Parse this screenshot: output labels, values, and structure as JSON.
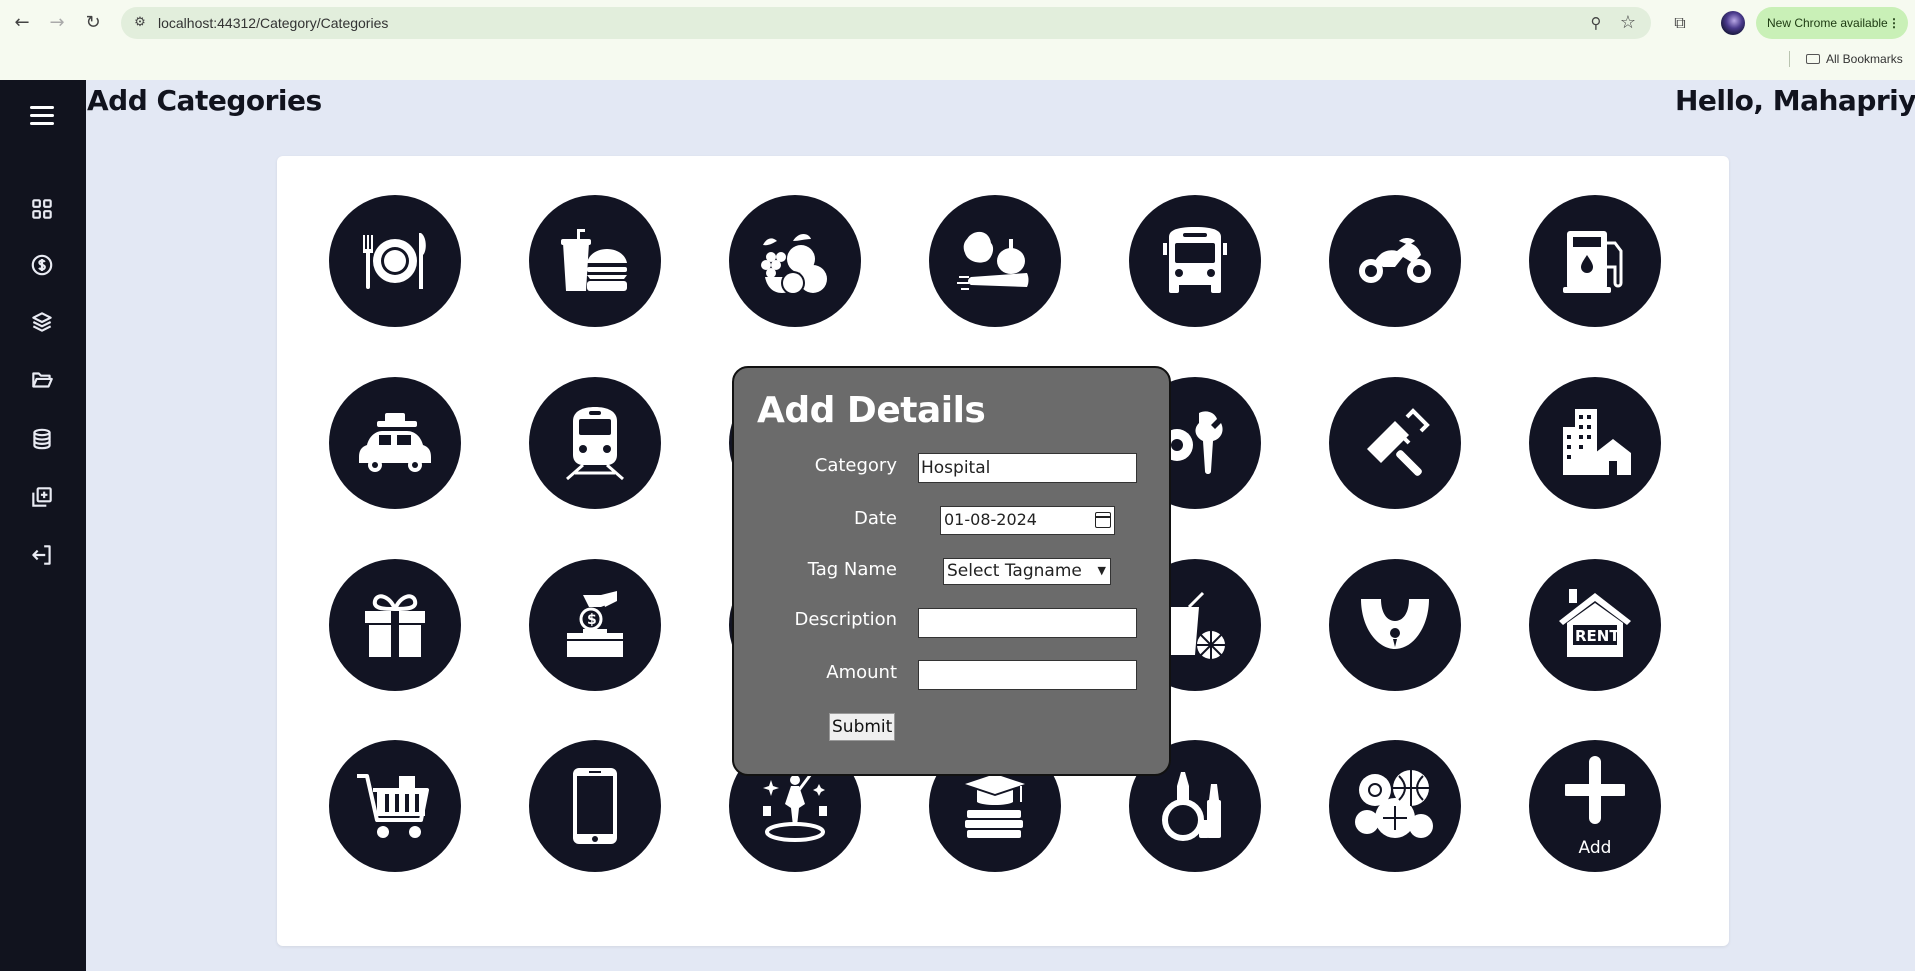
{
  "browser": {
    "url": "localhost:44312/Category/Categories",
    "new_chrome_label": "New Chrome available",
    "bookmarks_label": "All Bookmarks"
  },
  "header": {
    "title": "Add Categories",
    "greeting": "Hello, Mahapriya"
  },
  "sidebar": {
    "items": [
      {
        "icon": "dashboard-grid-icon"
      },
      {
        "icon": "dollar-coin-icon"
      },
      {
        "icon": "layers-icon"
      },
      {
        "icon": "folder-open-icon"
      },
      {
        "icon": "database-icon"
      },
      {
        "icon": "add-box-icon"
      },
      {
        "icon": "logout-icon"
      }
    ]
  },
  "categories": [
    {
      "icon": "dining-plate-icon"
    },
    {
      "icon": "fast-food-icon"
    },
    {
      "icon": "fruits-icon"
    },
    {
      "icon": "vegetables-icon"
    },
    {
      "icon": "bus-icon"
    },
    {
      "icon": "motorcycle-icon"
    },
    {
      "icon": "fuel-pump-icon"
    },
    {
      "icon": "car-travel-icon"
    },
    {
      "icon": "train-icon"
    },
    {
      "icon": "hidden-icon"
    },
    {
      "icon": "hidden-icon"
    },
    {
      "icon": "tools-icon"
    },
    {
      "icon": "paint-roller-icon"
    },
    {
      "icon": "buildings-icon"
    },
    {
      "icon": "gift-icon"
    },
    {
      "icon": "donation-icon"
    },
    {
      "icon": "hidden-icon"
    },
    {
      "icon": "hidden-icon"
    },
    {
      "icon": "drinks-icon"
    },
    {
      "icon": "necklace-icon"
    },
    {
      "icon": "rent-house-icon"
    },
    {
      "icon": "shopping-cart-icon"
    },
    {
      "icon": "mobile-phone-icon"
    },
    {
      "icon": "entertainment-icon"
    },
    {
      "icon": "education-icon"
    },
    {
      "icon": "cosmetics-icon"
    },
    {
      "icon": "sports-balls-icon"
    },
    {
      "icon": "add-plus-icon",
      "label": "Add"
    }
  ],
  "rent_text": "RENT",
  "modal": {
    "title": "Add Details",
    "category_label": "Category",
    "category_value": "Hospital",
    "date_label": "Date",
    "date_value": "01-08-2024",
    "tag_label": "Tag Name",
    "tag_value": "Select Tagname",
    "description_label": "Description",
    "description_value": "",
    "amount_label": "Amount",
    "amount_value": "",
    "submit_label": "Submit"
  },
  "colors": {
    "sidebar_bg": "#11131e",
    "page_bg": "#e3e8f4",
    "icon_circle": "#121423",
    "modal_bg": "#6b6b6b"
  }
}
